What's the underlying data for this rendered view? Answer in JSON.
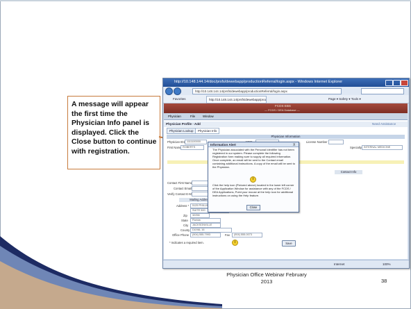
{
  "callout": {
    "text": "A message will appear the first time the Physician Info panel is displayed.  Click the Close button to continue with registration."
  },
  "footer": {
    "line1": "Physician Office Webinar February",
    "line2": "2013",
    "page_number": "38"
  },
  "browser": {
    "title": "http://10.148.144.14/doc/prsfs/dewebapp/productionReferral/login.aspx - Windows Internet Explorer",
    "address": "http://10.148.144.14/prsfs/dewebapp/productionReferral/login.aspx",
    "favorites_label": "Favorites",
    "tab_label": "http://10.148.144.14/prsfs/dewebapp/prodct...",
    "toolbar_label": "Page ▾  Safety ▾  Tools ▾",
    "status_zone": "Internet",
    "status_zoom": "100%"
  },
  "app": {
    "banner_title": "FCDS EBS",
    "banner_sub": "— FCDS / DEA Database —",
    "menu": [
      "Physician",
      "File",
      "Window"
    ],
    "page_title": "Physician Profile - Add",
    "page_link": "Need Assistance",
    "tabs": [
      "Physician Lookup",
      "Physician Info"
    ],
    "section_title": "Physician Information",
    "fields": {
      "physician_id_label": "Physician ID1 *",
      "physician_id_value": "1111100000",
      "npi_label": "NPI#",
      "license_label": "License Number",
      "first_name_label": "First Name *",
      "first_name_value": "ROBERTS",
      "specialty_label": "Specialty",
      "specialty_value": "INTERNAL MEDICINE"
    },
    "contact_head": "Contact Info",
    "contact_labels": [
      "Contact First Name",
      "Contact Email",
      "Verify Contact E-Mail"
    ],
    "mailing_head": "Mailing Address",
    "address_label": "Address *",
    "address_value": "5125 PHILLIPS HWY",
    "address2_value": "SUITE 500",
    "zip_label": "Zip",
    "zip_value": "32256",
    "state_label": "State",
    "state_value": "Florida",
    "city_label": "City",
    "city_value": "JACKSONVILLE",
    "county_label": "County",
    "county_value": "DUVAL 16",
    "office_phone_label": "Office Phone",
    "office_phone_value": "(904) 555-7993",
    "fax_label": "Fax",
    "fax_value": "(904) 555-0073",
    "required_note": "* Indicates a required item.",
    "save_label": "Save"
  },
  "modal": {
    "title": "Information Alert",
    "close_x": "X",
    "para1": "The Physician associated with the Personal Identifier has not been registered in our system. Please complete the following Registration form making sure to supply all required information. Once complete, an email will be sent to the Contact email containing additional instructions. A copy of the email will be sent to the Physician.",
    "para2": "Click the help icon (Pictured above) located in the lower left corner of the Application Window for assistance with any of the FCDS / DEA Applications, Point your mouse at the help icon for additional instructions on using the Help feature.",
    "close_label": "Close"
  }
}
